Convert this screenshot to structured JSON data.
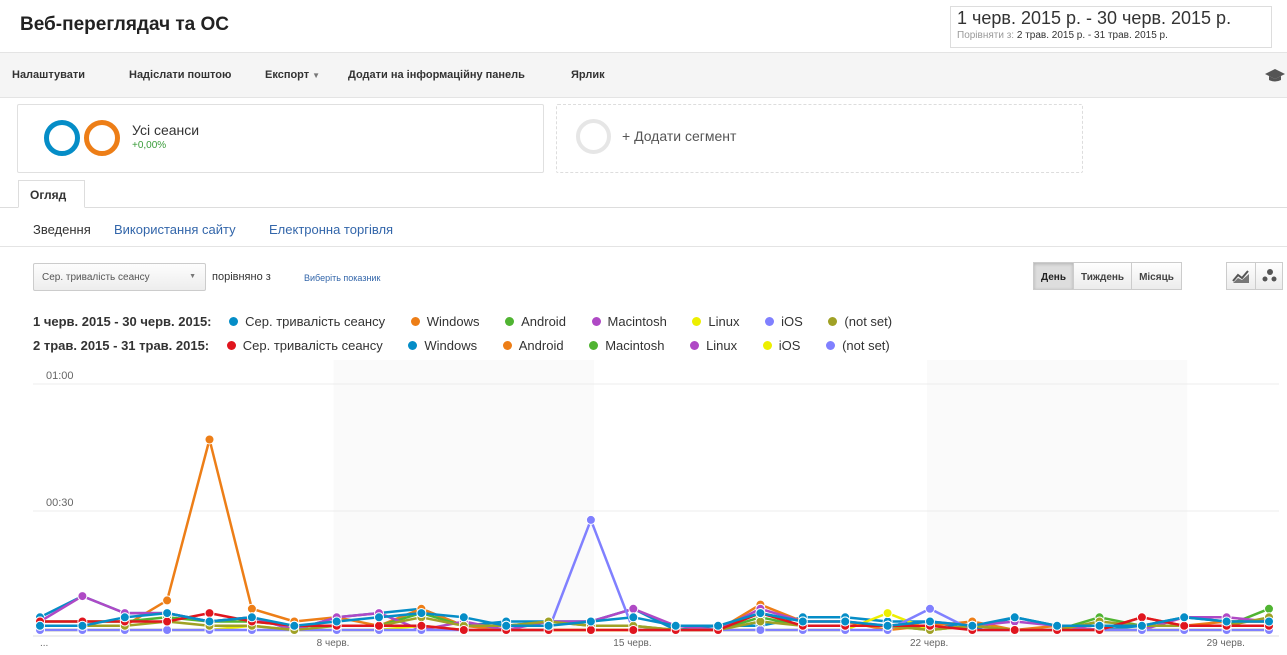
{
  "page": {
    "title": "Веб-переглядач та ОС",
    "date_range": "1 черв. 2015 р. - 30 черв. 2015 р.",
    "compare_label": "Порівняти з:",
    "compare_range": "2 трав. 2015 р. - 31 трав. 2015 р."
  },
  "toolbar": {
    "customize": "Налаштувати",
    "email": "Надіслати поштою",
    "export": "Експорт",
    "add_to_dashboard": "Додати на інформаційну панель",
    "shortcut": "Ярлик"
  },
  "segments": {
    "all_sessions": "Усі сеанси",
    "all_sessions_change": "+0,00%",
    "add_segment": "+ Додати сегмент"
  },
  "tabs": {
    "overview": "Огляд"
  },
  "subnav": {
    "summary": "Зведення",
    "site_usage": "Використання сайту",
    "ecommerce": "Електронна торгівля"
  },
  "controls": {
    "metric": "Сер. тривалість сеансу",
    "compared_with": "порівняно з",
    "choose_metric": "Виберіть показник",
    "day": "День",
    "week": "Тиждень",
    "month": "Місяць"
  },
  "icons": {
    "graduation-cap-icon": "mortarboard",
    "line-chart-icon": "line chart",
    "motion-chart-icon": "bubbles"
  },
  "chart_data": {
    "type": "line",
    "y_ticks": [
      "01:00",
      "00:30"
    ],
    "ylim_seconds": [
      0,
      60
    ],
    "x_tick_labels": [
      {
        "day": 1,
        "label": "..."
      },
      {
        "day": 8,
        "label": "8 черв."
      },
      {
        "day": 15,
        "label": "15 черв."
      },
      {
        "day": 22,
        "label": "22 черв."
      },
      {
        "day": 29,
        "label": "29 черв."
      }
    ],
    "legend": [
      {
        "period": "1 черв. 2015 - 30 черв. 2015:",
        "items": [
          {
            "name": "Сер. тривалість сеансу",
            "color": "#058dc7"
          },
          {
            "name": "Windows",
            "color": "#ed7e17"
          },
          {
            "name": "Android",
            "color": "#50b432"
          },
          {
            "name": "Macintosh",
            "color": "#af49c5"
          },
          {
            "name": "Linux",
            "color": "#edef00"
          },
          {
            "name": "iOS",
            "color": "#8080ff"
          },
          {
            "name": "(not set)",
            "color": "#a0a125"
          }
        ]
      },
      {
        "period": "2 трав. 2015 - 31 трав. 2015:",
        "items": [
          {
            "name": "Сер. тривалість сеансу",
            "color": "#e0151e"
          },
          {
            "name": "Windows",
            "color": "#058dc7"
          },
          {
            "name": "Android",
            "color": "#ed7e17"
          },
          {
            "name": "Macintosh",
            "color": "#50b432"
          },
          {
            "name": "Linux",
            "color": "#af49c5"
          },
          {
            "name": "iOS",
            "color": "#edef00"
          },
          {
            "name": "(not set)",
            "color": "#8080ff"
          }
        ]
      }
    ],
    "series": [
      {
        "color": "#058dc7",
        "values": [
          3,
          8,
          4,
          4,
          2,
          3,
          0,
          3,
          4,
          5,
          1,
          2,
          2,
          2,
          5,
          0,
          1,
          1,
          3,
          3,
          2,
          2,
          0,
          3,
          1,
          0,
          1,
          3,
          2,
          2
        ]
      },
      {
        "color": "#ed7e17",
        "values": [
          1,
          1,
          1,
          7,
          45,
          5,
          2,
          3,
          1,
          5,
          1,
          0,
          0,
          0,
          0,
          0,
          0,
          6,
          2,
          2,
          0,
          1,
          2,
          0,
          1,
          0,
          3,
          1,
          2,
          2
        ]
      },
      {
        "color": "#50b432",
        "values": [
          2,
          2,
          2,
          3,
          2,
          2,
          1,
          1,
          1,
          4,
          1,
          1,
          2,
          1,
          1,
          0,
          0,
          3,
          1,
          1,
          1,
          0,
          1,
          0,
          0,
          3,
          1,
          1,
          1,
          5
        ]
      },
      {
        "color": "#af49c5",
        "values": [
          2,
          8,
          4,
          4,
          2,
          3,
          0,
          3,
          4,
          0,
          2,
          0,
          2,
          2,
          5,
          1,
          0,
          5,
          2,
          2,
          1,
          2,
          1,
          2,
          1,
          0,
          0,
          3,
          3,
          2
        ]
      },
      {
        "color": "#edef00",
        "values": [
          0,
          0,
          0,
          0,
          0,
          1,
          0,
          0,
          0,
          1,
          0,
          0,
          0,
          0,
          0,
          0,
          0,
          0,
          0,
          0,
          4,
          0,
          1,
          0,
          0,
          0,
          0,
          0,
          0,
          0
        ]
      },
      {
        "color": "#8080ff",
        "values": [
          0,
          0,
          0,
          0,
          0,
          0,
          0,
          0,
          0,
          0,
          0,
          0,
          0,
          26,
          0,
          0,
          0,
          0,
          0,
          0,
          0,
          5,
          0,
          0,
          0,
          0,
          0,
          0,
          0,
          0
        ]
      },
      {
        "color": "#a0a125",
        "values": [
          1,
          1,
          1,
          2,
          1,
          1,
          0,
          1,
          1,
          3,
          1,
          1,
          2,
          1,
          1,
          0,
          0,
          2,
          1,
          1,
          1,
          0,
          1,
          0,
          0,
          2,
          1,
          1,
          1,
          3
        ]
      },
      {
        "color": "#e0151e",
        "values": [
          2,
          2,
          2,
          2,
          4,
          2,
          1,
          1,
          1,
          1,
          0,
          0,
          0,
          0,
          0,
          0,
          0,
          4,
          1,
          1,
          1,
          1,
          0,
          0,
          0,
          0,
          3,
          1,
          1,
          1
        ]
      },
      {
        "color": "#058dc7",
        "values": [
          1,
          1,
          3,
          4,
          2,
          3,
          1,
          2,
          3,
          4,
          3,
          1,
          1,
          2,
          3,
          1,
          1,
          4,
          2,
          2,
          1,
          2,
          1,
          3,
          1,
          1,
          1,
          3,
          2,
          2
        ]
      }
    ]
  }
}
